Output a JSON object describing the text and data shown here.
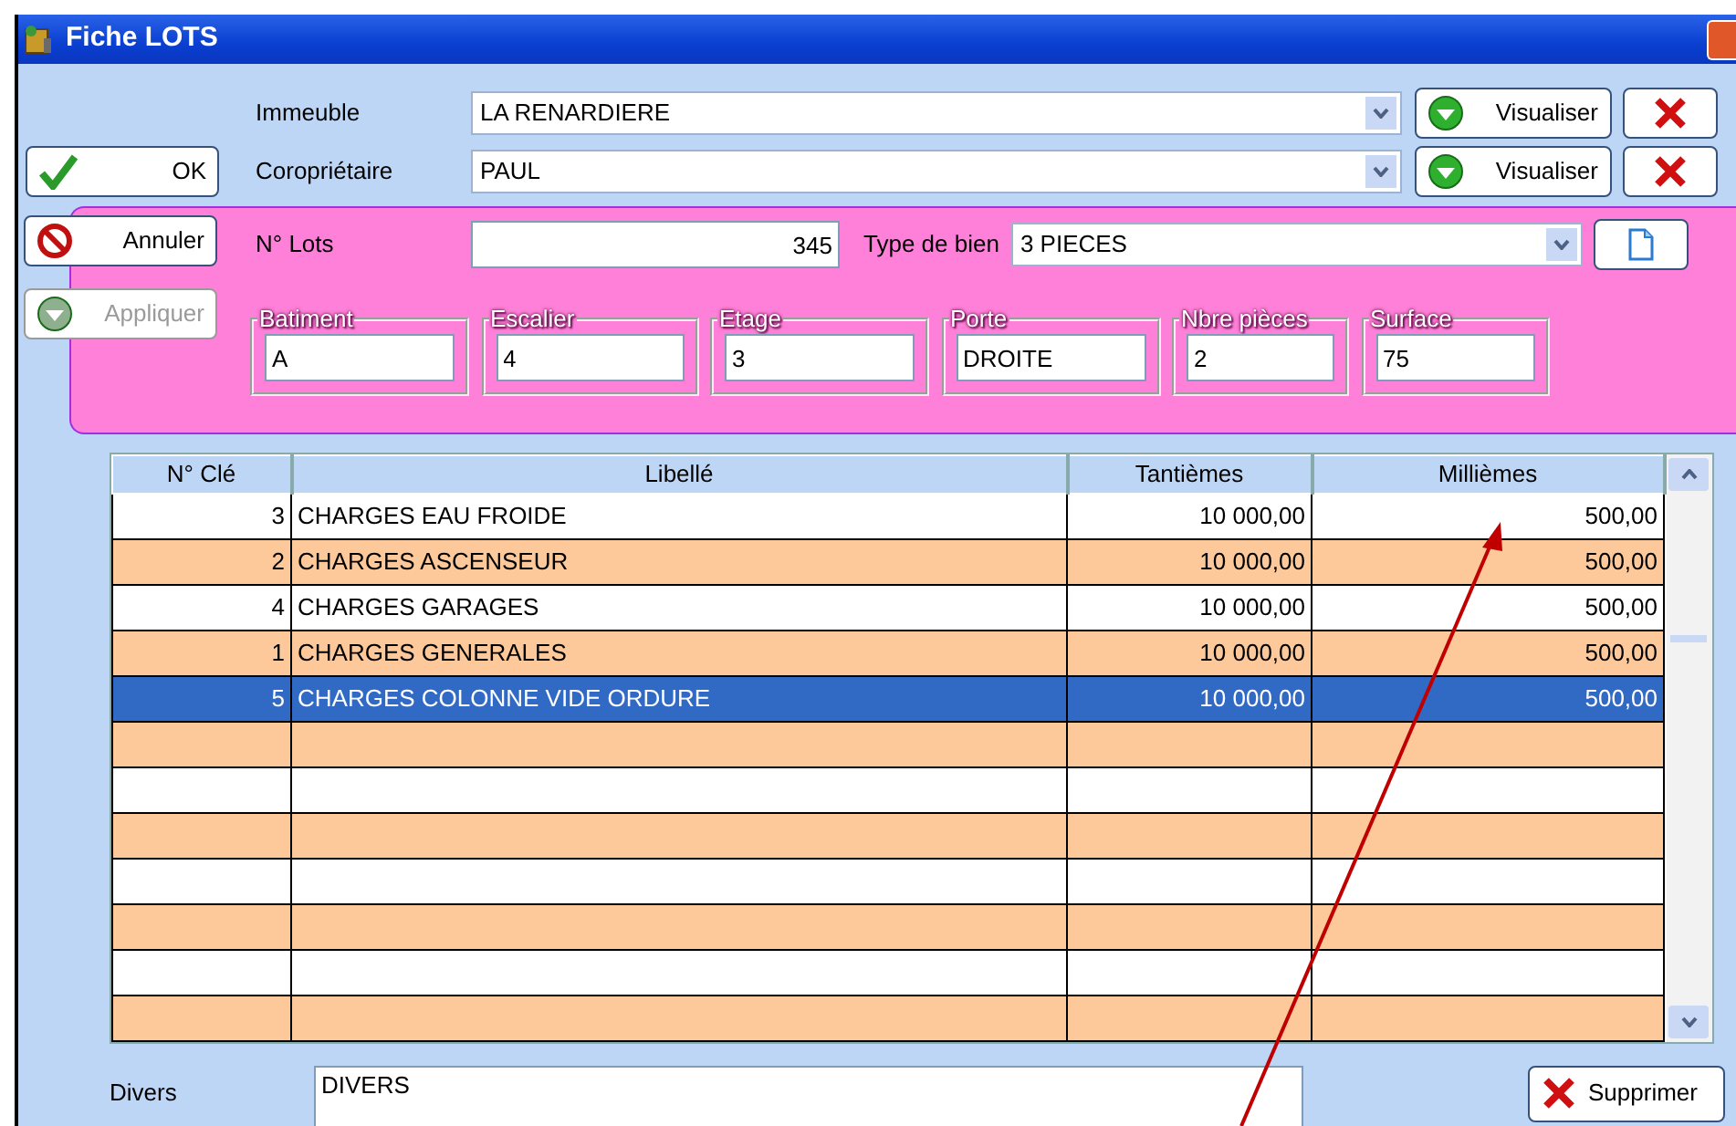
{
  "window": {
    "title": "Fiche LOTS"
  },
  "side_buttons": [
    {
      "kind": "ok",
      "label": "OK",
      "disabled": false
    },
    {
      "kind": "cancel",
      "label": "Annuler",
      "disabled": false
    },
    {
      "kind": "apply",
      "label": "Appliquer",
      "disabled": true
    }
  ],
  "header_fields": [
    {
      "label": "Immeuble",
      "value": "LA RENARDIERE",
      "button": "Visualiser"
    },
    {
      "label": "Coropriétaire",
      "value": "PAUL",
      "button": "Visualiser"
    }
  ],
  "lot": {
    "label": "N° Lots",
    "value": "345"
  },
  "type_bien": {
    "label": "Type de bien",
    "value": "3 PIECES"
  },
  "groups": [
    {
      "label": "Batiment",
      "value": "A"
    },
    {
      "label": "Escalier",
      "value": "4"
    },
    {
      "label": "Etage",
      "value": "3"
    },
    {
      "label": "Porte",
      "value": "DROITE"
    },
    {
      "label": "Nbre pièces",
      "value": "2"
    },
    {
      "label": "Surface",
      "value": "75"
    }
  ],
  "table": {
    "columns": [
      "N° Clé",
      "Libellé",
      "Tantièmes",
      "Millièmes"
    ],
    "rows": [
      {
        "cells": [
          "3",
          "CHARGES EAU FROIDE",
          "10 000,00",
          "500,00"
        ],
        "selected": false
      },
      {
        "cells": [
          "2",
          "CHARGES ASCENSEUR",
          "10 000,00",
          "500,00"
        ],
        "selected": false
      },
      {
        "cells": [
          "4",
          "CHARGES GARAGES",
          "10 000,00",
          "500,00"
        ],
        "selected": false
      },
      {
        "cells": [
          "1",
          "CHARGES GENERALES",
          "10 000,00",
          "500,00"
        ],
        "selected": false
      },
      {
        "cells": [
          "5",
          "CHARGES COLONNE VIDE ORDURE",
          "10 000,00",
          "500,00"
        ],
        "selected": true
      }
    ]
  },
  "divers": {
    "label": "Divers",
    "value": "DIVERS"
  },
  "delete_button": {
    "label": "Supprimer"
  }
}
